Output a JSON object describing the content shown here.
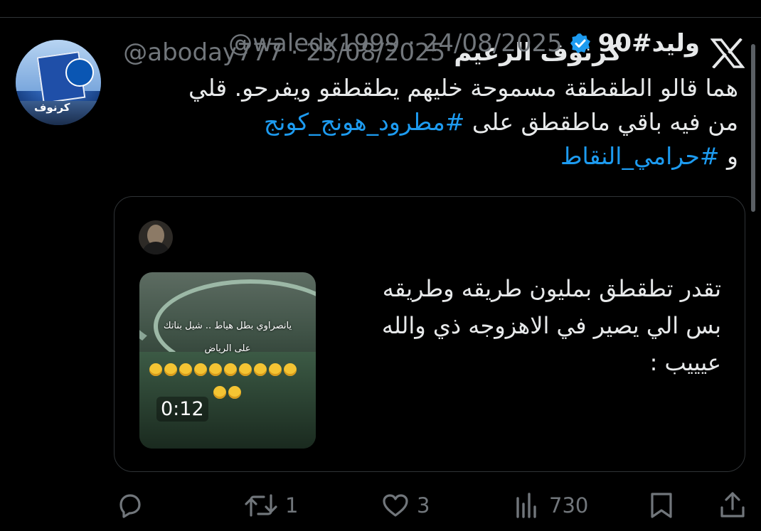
{
  "tweet": {
    "author_name": "كرنوف الزعيم",
    "handle_date": "@aboday777 · 25/08/2025",
    "avatar_text": "كرنوف",
    "lines": [
      {
        "text": "هما قالو الطقطقة مسموحة خليهم يطقطقو  ويفرحو. قلي",
        "hashtag": ""
      },
      {
        "text": "من فيه باقي ماطقطق على ",
        "hashtag": "#مطرود_هونج_كونج"
      },
      {
        "text": "و ",
        "hashtag": "#حرامي_النقاط"
      }
    ]
  },
  "quote": {
    "author_name": "وليد#90",
    "handle_date": "@waledx1999 · 24/08/2025",
    "lines": [
      "تقدر تطقطق بمليون طريقه وطريقه",
      "بس الي يصير في الاهزوجه ذي والله",
      "عيييب :"
    ],
    "video": {
      "caption_line1": "يانصراوي بطل هياط .. شيل بناتك",
      "caption_line2": "على الرياض",
      "duration": "0:12"
    }
  },
  "actions": {
    "reply_count": "",
    "retweet_count": "1",
    "like_count": "3",
    "views_count": "730"
  },
  "colors": {
    "background": "#000000",
    "text": "#e7e9ea",
    "muted": "#71767b",
    "link": "#1d9bf0",
    "verified": "#1d9bf0"
  },
  "icons": [
    "x-logo-icon",
    "verified-badge-icon",
    "reply-icon",
    "retweet-icon",
    "like-icon",
    "views-icon",
    "bookmark-icon",
    "share-icon"
  ]
}
